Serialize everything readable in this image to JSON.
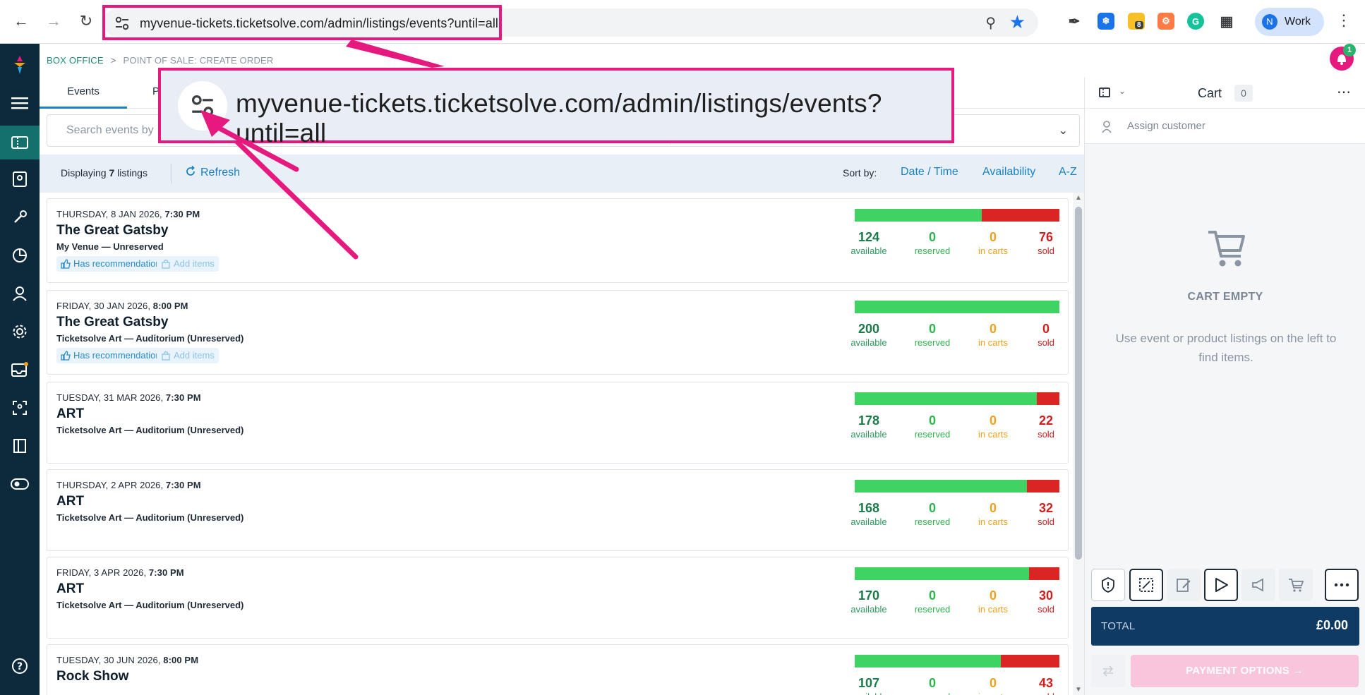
{
  "browser": {
    "url": "myvenue-tickets.ticketsolve.com/admin/listings/events?until=all",
    "profile_initial": "N",
    "profile_label": "Work",
    "extension_badge": "8"
  },
  "breadcrumb": {
    "root": "BOX OFFICE",
    "separator": ">",
    "current": "POINT OF SALE: CREATE ORDER"
  },
  "tabs": [
    {
      "label": "Events"
    },
    {
      "label": "P"
    }
  ],
  "search": {
    "placeholder": "Search events by"
  },
  "listbar": {
    "displaying_prefix": "Displaying ",
    "displaying_count": "7",
    "displaying_suffix": " listings",
    "refresh_label": "Refresh",
    "sort_label": "Sort by:",
    "sort_options": [
      "Date / Time",
      "Availability",
      "A-Z"
    ]
  },
  "stat_labels": {
    "available": "available",
    "reserved": "reserved",
    "in_carts": "in carts",
    "sold": "sold"
  },
  "events": [
    {
      "date": "THURSDAY, 8 JAN 2026, ",
      "time": "7:30 PM",
      "title": "The Great Gatsby",
      "venue": "My Venue — Unreserved",
      "has_recommendations": "Has recommendations",
      "add_items": "Add items",
      "available": "124",
      "reserved": "0",
      "in_carts": "0",
      "sold": "76"
    },
    {
      "date": "FRIDAY, 30 JAN 2026, ",
      "time": "8:00 PM",
      "title": "The Great Gatsby",
      "venue": "Ticketsolve Art — Auditorium (Unreserved)",
      "has_recommendations": "Has recommendations",
      "add_items": "Add items",
      "available": "200",
      "reserved": "0",
      "in_carts": "0",
      "sold": "0"
    },
    {
      "date": "TUESDAY, 31 MAR 2026, ",
      "time": "7:30 PM",
      "title": "ART",
      "venue": "Ticketsolve Art — Auditorium (Unreserved)",
      "available": "178",
      "reserved": "0",
      "in_carts": "0",
      "sold": "22"
    },
    {
      "date": "THURSDAY, 2 APR 2026, ",
      "time": "7:30 PM",
      "title": "ART",
      "venue": "Ticketsolve Art — Auditorium (Unreserved)",
      "available": "168",
      "reserved": "0",
      "in_carts": "0",
      "sold": "32"
    },
    {
      "date": "FRIDAY, 3 APR 2026, ",
      "time": "7:30 PM",
      "title": "ART",
      "venue": "Ticketsolve Art — Auditorium (Unreserved)",
      "available": "170",
      "reserved": "0",
      "in_carts": "0",
      "sold": "30"
    },
    {
      "date": "TUESDAY, 30 JUN 2026, ",
      "time": "8:00 PM",
      "title": "Rock Show",
      "venue": "",
      "available": "107",
      "reserved": "0",
      "in_carts": "0",
      "sold": "43"
    }
  ],
  "cart": {
    "title": "Cart",
    "count": "0",
    "assign_customer": "Assign customer",
    "empty_title": "CART EMPTY",
    "empty_message": "Use event or product listings on the left to find items.",
    "total_label": "TOTAL",
    "total_amount": "£0.00",
    "payment_options": "PAYMENT OPTIONS →"
  },
  "notification_count": "1",
  "colors": {
    "annotation": "#e6197e",
    "sidebar": "#0d2a3d",
    "available_bar": "#3fd364",
    "sold_bar": "#db2525",
    "link": "#1a82c4"
  }
}
